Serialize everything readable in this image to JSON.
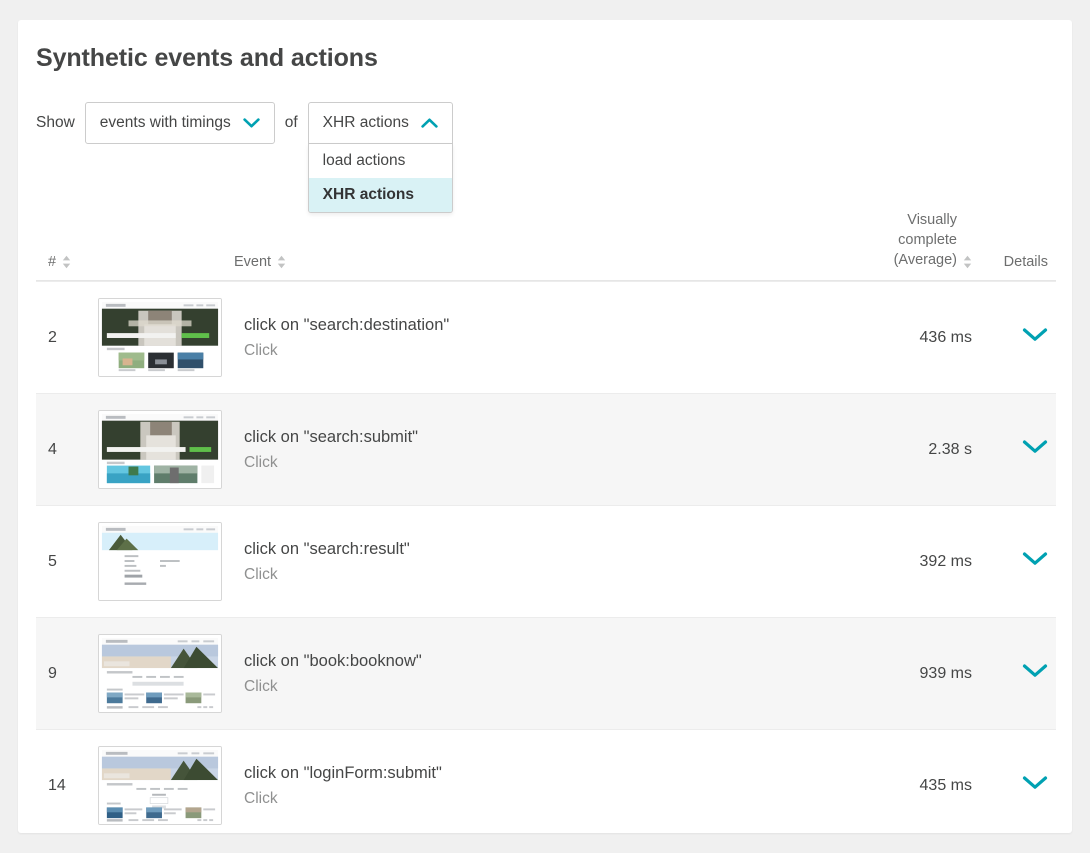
{
  "card": {
    "title": "Synthetic events and actions"
  },
  "filter": {
    "show_label": "Show",
    "of_label": "of",
    "type_select": {
      "value": "events with timings",
      "caret_icon": "chevron-down-icon"
    },
    "action_select": {
      "value": "XHR actions",
      "caret_icon": "chevron-up-icon",
      "open": true,
      "options": [
        {
          "label": "load actions",
          "selected": false
        },
        {
          "label": "XHR actions",
          "selected": true
        }
      ]
    }
  },
  "table": {
    "headers": {
      "num": "#",
      "event": "Event",
      "metric": "Visually\ncomplete\n(Average)",
      "details": "Details"
    },
    "sort_icon": "sort-arrows-icon",
    "expand_icon": "chevron-down-icon",
    "rows": [
      {
        "num": "2",
        "title": "click on \"search:destination\"",
        "subtitle": "Click",
        "metric": "436 ms",
        "thumb": "hero-dark-people"
      },
      {
        "num": "4",
        "title": "click on \"search:submit\"",
        "subtitle": "Click",
        "metric": "2.38 s",
        "thumb": "hero-dark-people-cards"
      },
      {
        "num": "5",
        "title": "click on \"search:result\"",
        "subtitle": "Click",
        "metric": "392 ms",
        "thumb": "detail-form"
      },
      {
        "num": "9",
        "title": "click on \"book:booknow\"",
        "subtitle": "Click",
        "metric": "939 ms",
        "thumb": "hero-sky-list"
      },
      {
        "num": "14",
        "title": "click on \"loginForm:submit\"",
        "subtitle": "Click",
        "metric": "435 ms",
        "thumb": "hero-sky-login"
      }
    ]
  },
  "colors": {
    "accent": "#00a1b2",
    "text": "#454646",
    "muted": "#8f9090",
    "row_alt": "#f6f6f6",
    "dropdown_selected": "#d9f2f5",
    "page_bg": "#f0f0f0"
  }
}
